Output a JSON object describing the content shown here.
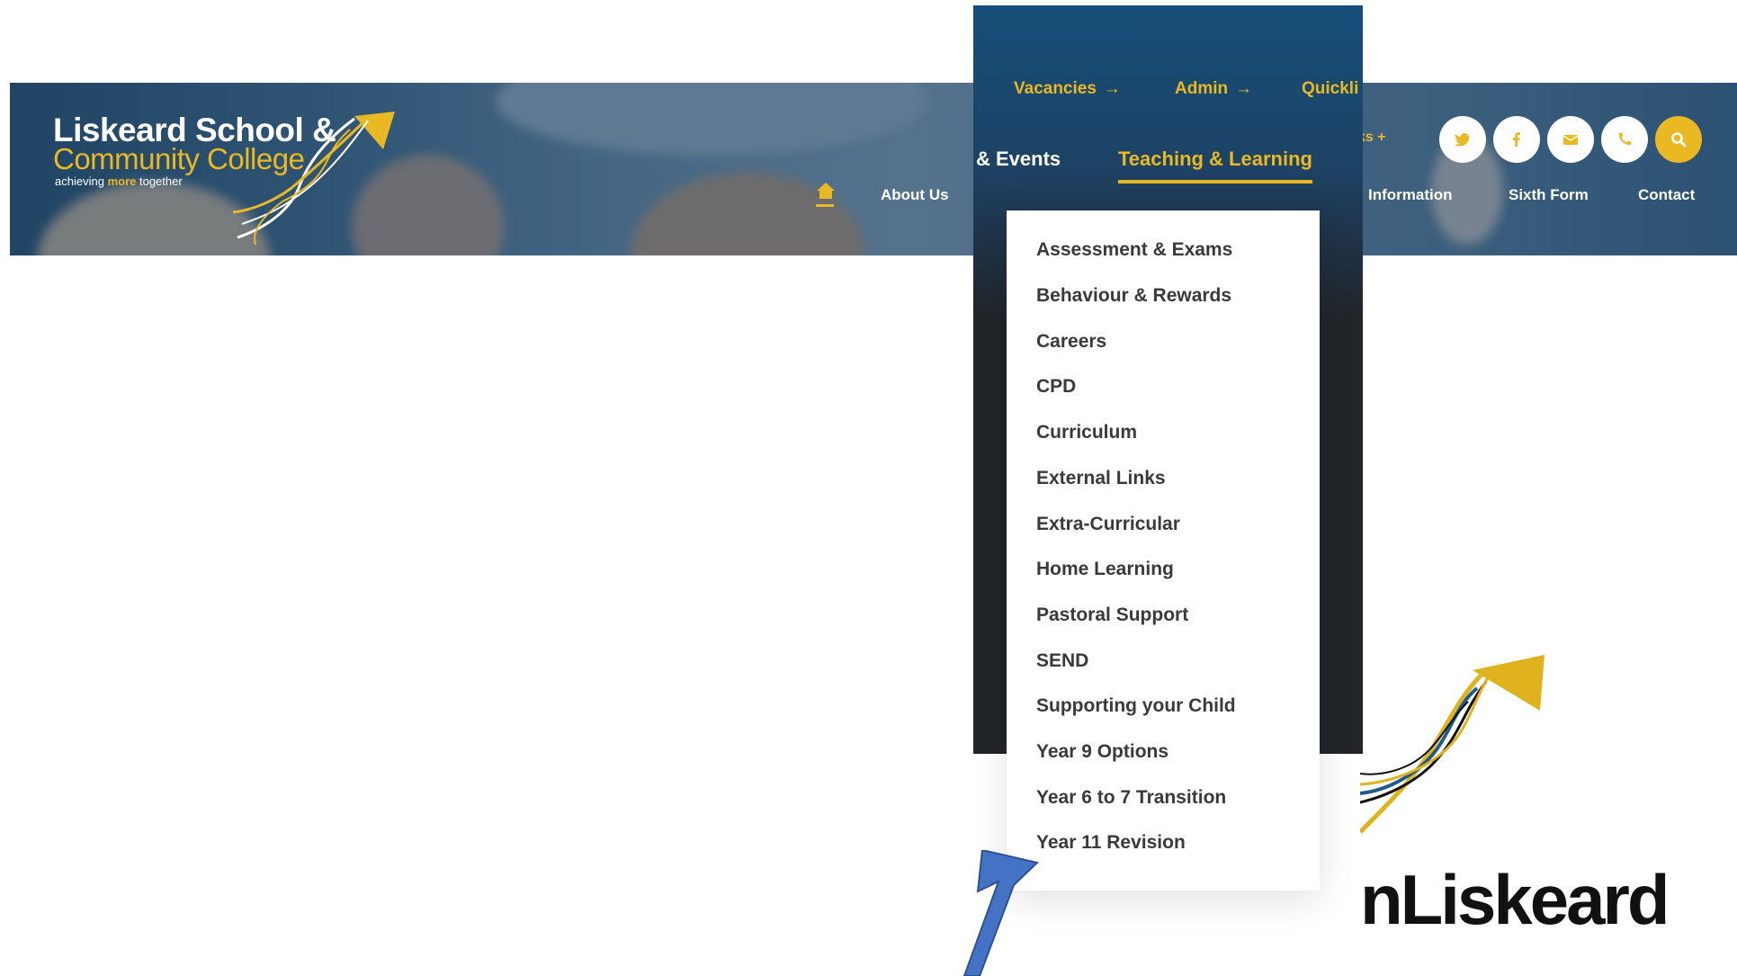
{
  "logo": {
    "line1": "Liskeard School &",
    "line2": "Community College",
    "tagline_pre": "achieving",
    "tagline_more": "more",
    "tagline_post": "together"
  },
  "header_nav": {
    "about": "About Us",
    "information": "Information",
    "sixth_form": "Sixth Form",
    "contact": "Contact",
    "quicklinks_stub": "ks +"
  },
  "utility_nav": {
    "vacancies": "Vacancies",
    "admin": "Admin",
    "quicklinks": "Quickli"
  },
  "main_nav": {
    "events": "& Events",
    "teaching": "Teaching & Learning"
  },
  "dropdown": {
    "items": [
      "Assessment & Exams",
      "Behaviour & Rewards",
      "Careers",
      "CPD",
      "Curriculum",
      "External Links",
      "Extra-Curricular",
      "Home Learning",
      "Pastoral Support",
      "SEND",
      "Supporting your Child",
      "Year 9 Options",
      "Year 6 to 7 Transition",
      "Year 11 Revision"
    ]
  },
  "brand": {
    "text": "nLiskeard"
  },
  "icons": {
    "social": [
      "twitter-icon",
      "facebook-icon",
      "email-icon",
      "phone-icon",
      "search-icon"
    ],
    "home": "home-icon",
    "arrow": "annotation-arrow"
  },
  "colors": {
    "accent": "#e9b823",
    "panel_dark": "#212529",
    "panel_blue": "#174f7a",
    "annotation_arrow": "#4472c4"
  }
}
